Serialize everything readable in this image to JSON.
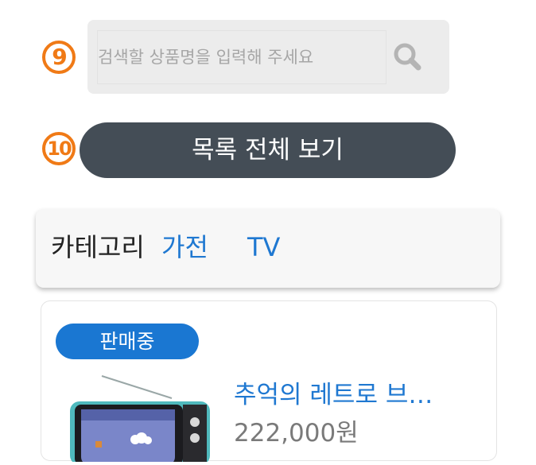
{
  "steps": {
    "search_step": "9",
    "list_step": "10"
  },
  "search": {
    "placeholder": "검색할 상품명을 입력해 주세요",
    "value": "",
    "button_icon": "search-icon"
  },
  "list_all": {
    "label": "목록 전체 보기"
  },
  "category": {
    "label": "카테고리",
    "items": [
      "가전",
      "TV"
    ]
  },
  "product": {
    "status": "판매중",
    "title": "추억의 레트로 브…",
    "price": "222,000원",
    "thumbnail_icon": "retro-tv-icon"
  },
  "colors": {
    "step_badge": "#f07a16",
    "primary_blue": "#1f78d1",
    "list_button": "#444d56",
    "status_badge": "#1a77d2"
  }
}
